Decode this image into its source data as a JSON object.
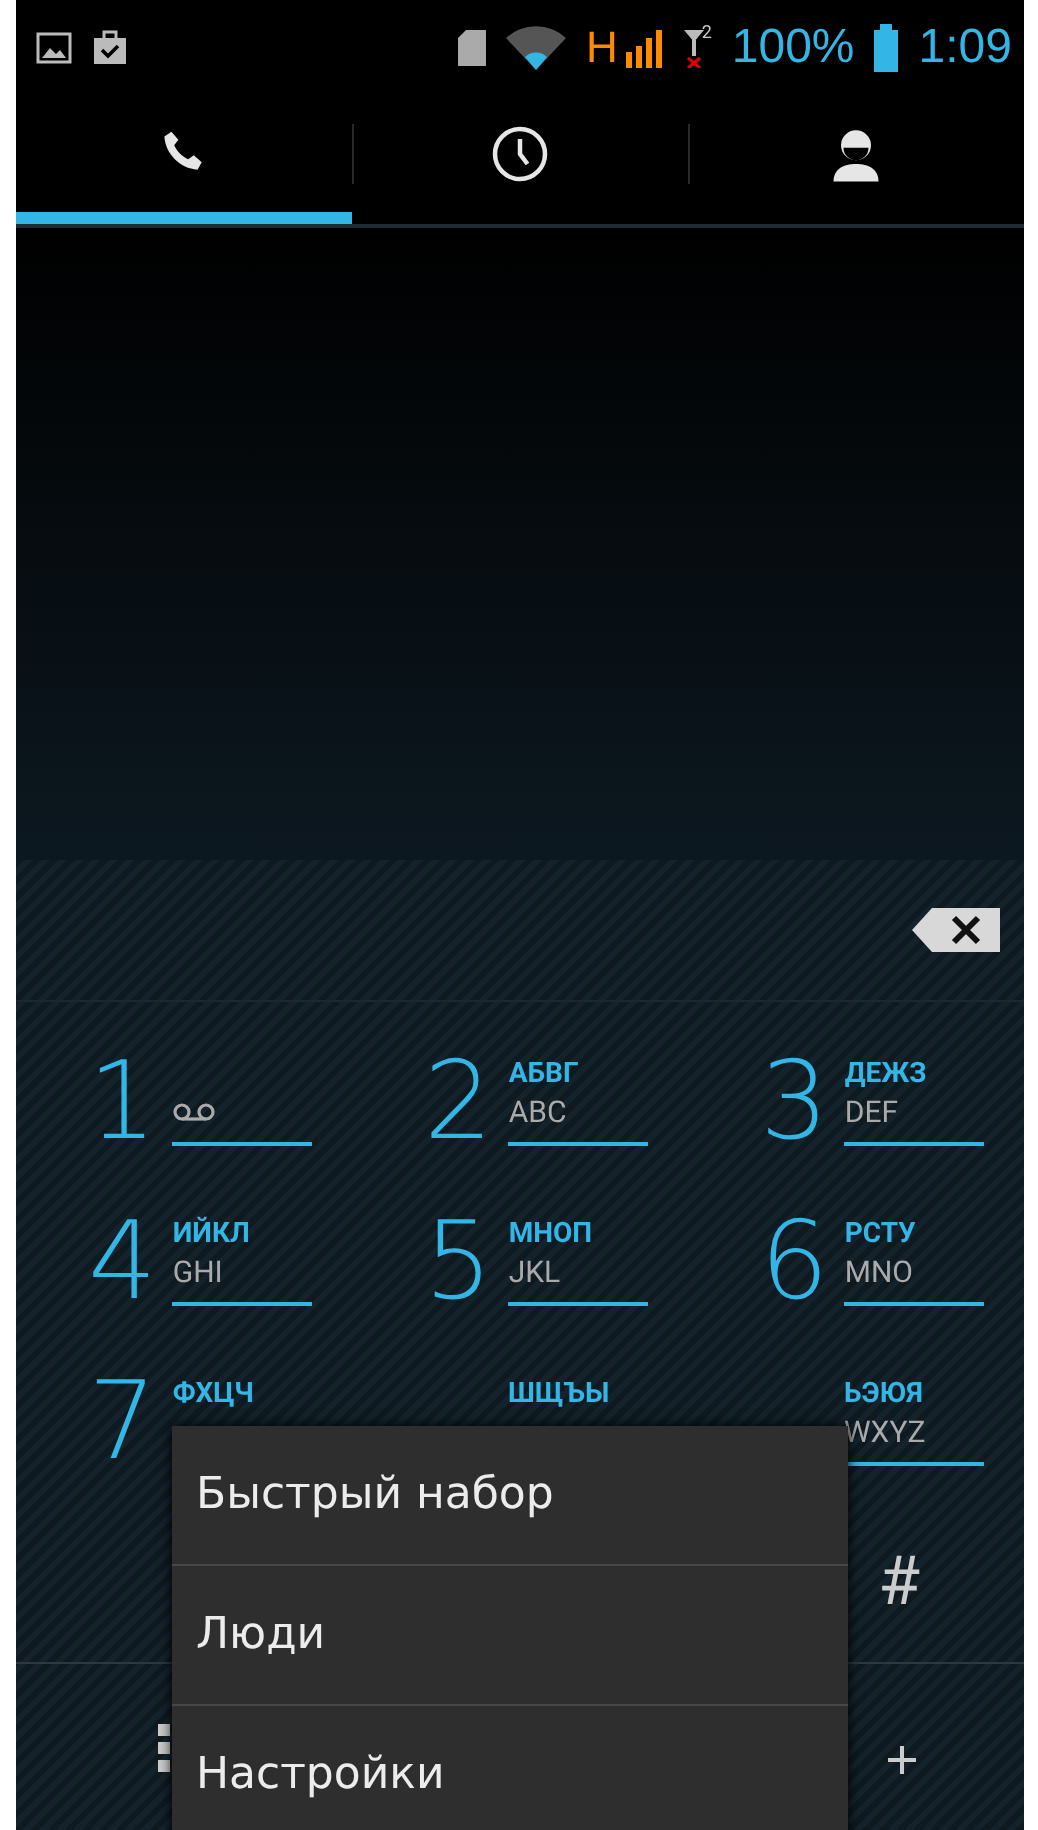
{
  "status_bar": {
    "network_type": "H",
    "sim_slot": "2",
    "battery": "100%",
    "time": "1:09"
  },
  "tabs": [
    {
      "kind": "phone",
      "selected": true
    },
    {
      "kind": "clock",
      "selected": false
    },
    {
      "kind": "contacts",
      "selected": false
    }
  ],
  "keypad": {
    "rows": [
      [
        {
          "digit": "1",
          "kind": "voicemail"
        },
        {
          "digit": "2",
          "kind": "letters",
          "cyrillic": "АБВГ",
          "latin": "ABC"
        },
        {
          "digit": "3",
          "kind": "letters",
          "cyrillic": "ДЕЖЗ",
          "latin": "DEF"
        }
      ],
      [
        {
          "digit": "4",
          "kind": "letters",
          "cyrillic": "ИЙКЛ",
          "latin": "GHI"
        },
        {
          "digit": "5",
          "kind": "letters",
          "cyrillic": "МНОП",
          "latin": "JKL"
        },
        {
          "digit": "6",
          "kind": "letters",
          "cyrillic": "РСТУ",
          "latin": "MNO"
        }
      ],
      [
        {
          "digit": "7",
          "kind": "letters",
          "cyrillic": "ФХЦЧ"
        },
        {
          "kind": "letters",
          "cyrillic": "ШЩЪЫ"
        },
        {
          "kind": "letters",
          "cyrillic": "ЬЭЮЯ",
          "latin": "WXYZ"
        }
      ]
    ],
    "hash_key": "#"
  },
  "menu": {
    "items": [
      "Быстрый набор",
      "Люди",
      "Настройки"
    ]
  }
}
